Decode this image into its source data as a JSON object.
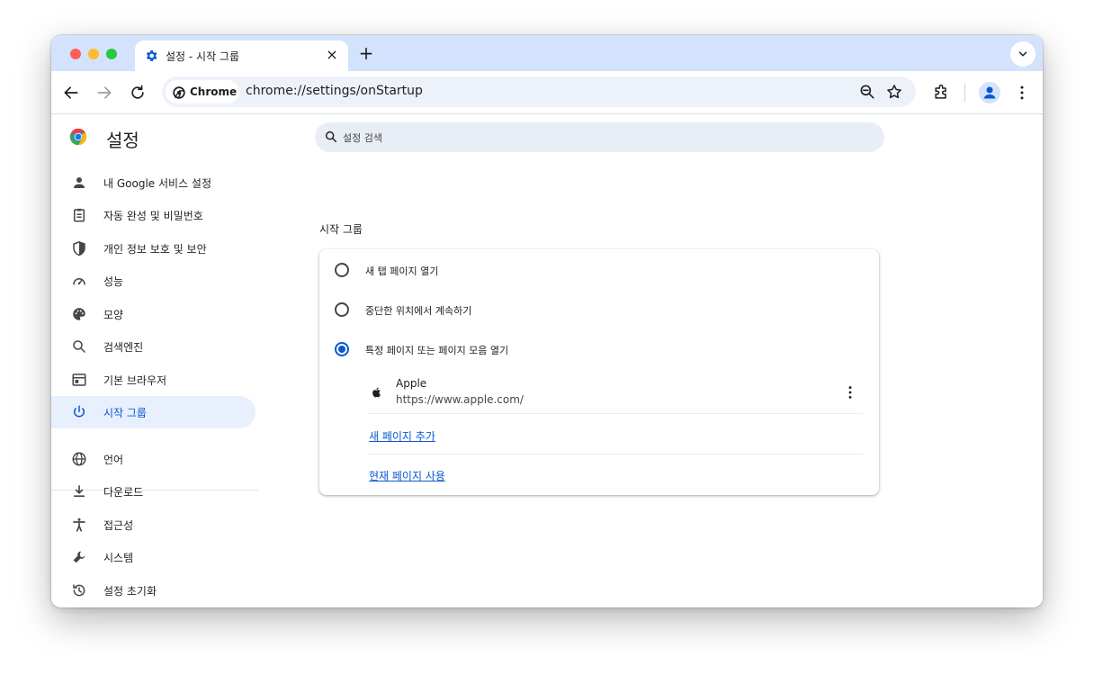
{
  "tab": {
    "title": "설정 - 시작 그룹",
    "close": "×",
    "new_tab": "+"
  },
  "omnibox": {
    "chip_label": "Chrome",
    "url": "chrome://settings/onStartup"
  },
  "settings": {
    "title": "설정",
    "search_placeholder": "설정 검색"
  },
  "nav": {
    "items": [
      {
        "label": "내 Google 서비스 설정",
        "icon": "person-icon"
      },
      {
        "label": "자동 완성 및 비밀번호",
        "icon": "clipboard-icon"
      },
      {
        "label": "개인 정보 보호 및 보안",
        "icon": "shield-icon"
      },
      {
        "label": "성능",
        "icon": "speedometer-icon"
      },
      {
        "label": "모양",
        "icon": "palette-icon"
      },
      {
        "label": "검색엔진",
        "icon": "search-icon"
      },
      {
        "label": "기본 브라우저",
        "icon": "browser-icon"
      },
      {
        "label": "시작 그룹",
        "icon": "power-icon",
        "active": true
      },
      {
        "label": "언어",
        "icon": "globe-icon"
      },
      {
        "label": "다운로드",
        "icon": "download-icon"
      },
      {
        "label": "접근성",
        "icon": "accessibility-icon"
      },
      {
        "label": "시스템",
        "icon": "wrench-icon"
      },
      {
        "label": "설정 초기화",
        "icon": "history-icon"
      }
    ]
  },
  "startup": {
    "section_title": "시작 그룹",
    "options": [
      {
        "label": "새 탭 페이지 열기",
        "checked": false
      },
      {
        "label": "중단한 위치에서 계속하기",
        "checked": false
      },
      {
        "label": "특정 페이지 또는 페이지 모음 열기",
        "checked": true
      }
    ],
    "pages": [
      {
        "name": "Apple",
        "url": "https://www.apple.com/"
      }
    ],
    "add_page": "새 페이지 추가",
    "use_current": "현재 페이지 사용"
  },
  "colors": {
    "accent": "#0b57d0",
    "tabstrip": "#d3e3fd",
    "active_nav": "#e8f0fe"
  }
}
